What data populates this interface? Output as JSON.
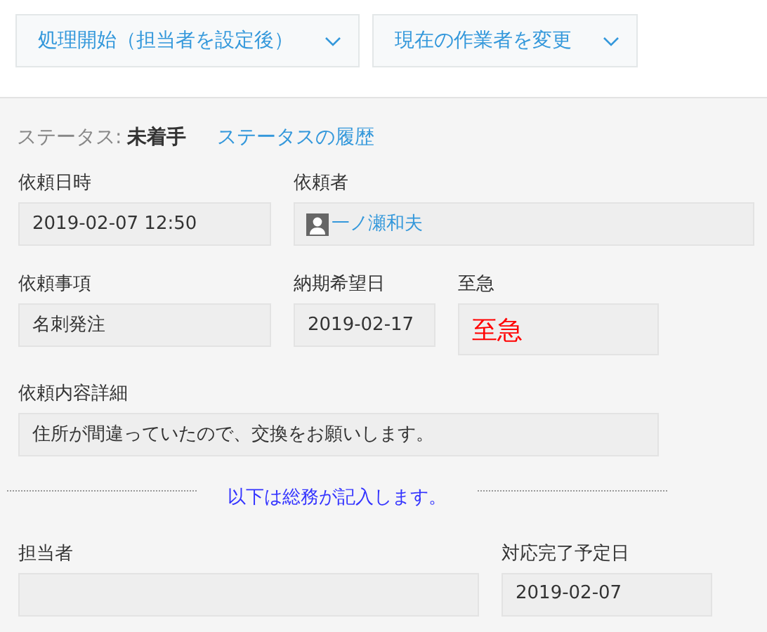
{
  "actions": [
    {
      "label": "処理開始（担当者を設定後）"
    },
    {
      "label": "現在の作業者を変更"
    }
  ],
  "status": {
    "label": "ステータス:",
    "value": "未着手",
    "history_link": "ステータスの履歴"
  },
  "rows": [
    [
      {
        "label": "依頼日時",
        "kind": "text",
        "value": "2019-02-07 12:50"
      },
      {
        "label": "依頼者",
        "kind": "user",
        "value": "一ノ瀬和夫"
      }
    ],
    [
      {
        "label": "依頼事項",
        "kind": "text",
        "value": "名刺発注"
      },
      {
        "label": "納期希望日",
        "kind": "text",
        "value": "2019-02-17"
      },
      {
        "label": "至急",
        "kind": "urgent",
        "value": "至急"
      }
    ],
    [
      {
        "label": "依頼内容詳細",
        "kind": "text",
        "value": "住所が間違っていたので、交換をお願いします。"
      }
    ],
    {
      "kind": "divider",
      "text": "以下は総務が記入します。"
    },
    [
      {
        "label": "担当者",
        "kind": "empty"
      },
      {
        "label": "対応完了予定日",
        "kind": "text",
        "value": "2019-02-07"
      }
    ]
  ]
}
